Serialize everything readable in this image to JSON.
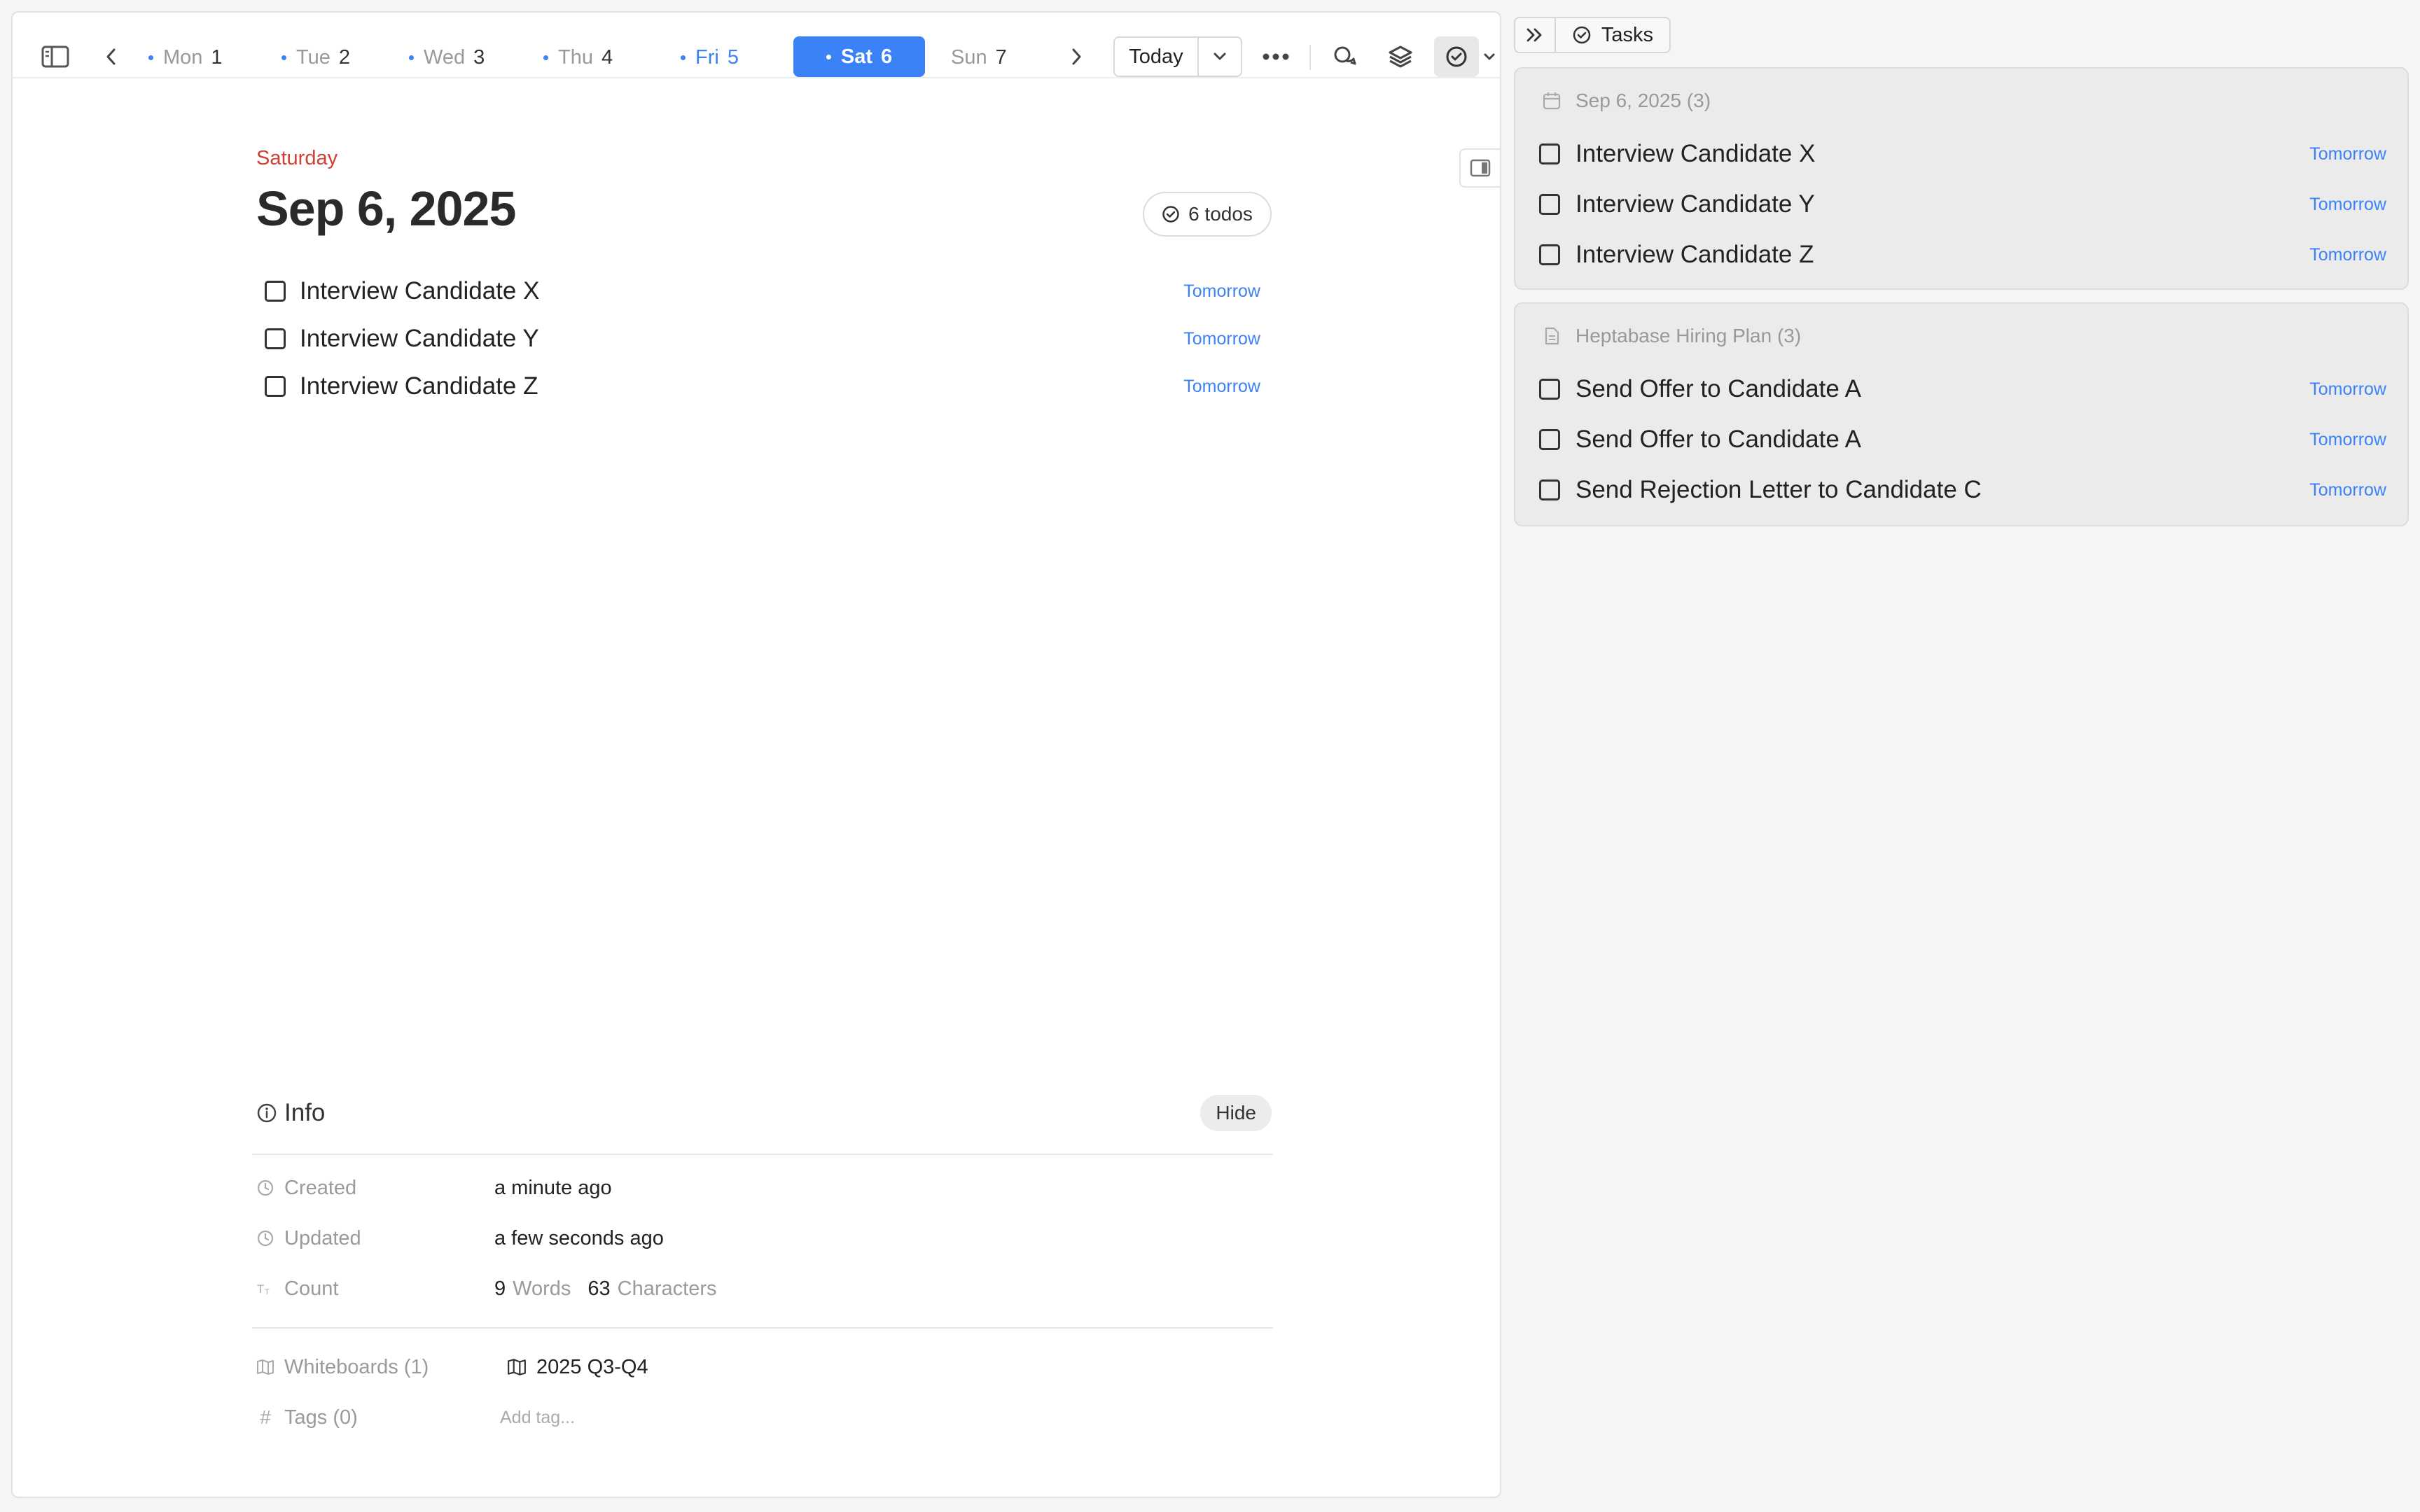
{
  "topbar": {
    "days": [
      {
        "label": "Mon",
        "num": "1"
      },
      {
        "label": "Tue",
        "num": "2"
      },
      {
        "label": "Wed",
        "num": "3"
      },
      {
        "label": "Thu",
        "num": "4"
      },
      {
        "label": "Fri",
        "num": "5"
      },
      {
        "label": "Sat",
        "num": "6"
      },
      {
        "label": "Sun",
        "num": "7"
      }
    ],
    "today_label": "Today",
    "accent": "#3b82f6"
  },
  "journal": {
    "weekday": "Saturday",
    "date": "Sep 6, 2025",
    "todo_count": "6 todos",
    "tasks": [
      {
        "text": "Interview Candidate X",
        "due": "Tomorrow"
      },
      {
        "text": "Interview Candidate Y",
        "due": "Tomorrow"
      },
      {
        "text": "Interview Candidate Z",
        "due": "Tomorrow"
      }
    ]
  },
  "info": {
    "title": "Info",
    "hide_label": "Hide",
    "created_label": "Created",
    "created_value": "a minute ago",
    "updated_label": "Updated",
    "updated_value": "a few seconds ago",
    "count_label": "Count",
    "words_num": "9",
    "words_label": "Words",
    "chars_num": "63",
    "chars_label": "Characters",
    "whiteboards_label": "Whiteboards (1)",
    "whiteboard_name": "2025 Q3-Q4",
    "tags_label": "Tags (0)",
    "add_tag": "Add tag..."
  },
  "tasks_panel": {
    "title": "Tasks",
    "groups": [
      {
        "heading": "Sep 6, 2025 (3)",
        "icon": "calendar-icon",
        "items": [
          {
            "text": "Interview Candidate X",
            "due": "Tomorrow"
          },
          {
            "text": "Interview Candidate Y",
            "due": "Tomorrow"
          },
          {
            "text": "Interview Candidate Z",
            "due": "Tomorrow"
          }
        ]
      },
      {
        "heading": "Heptabase Hiring Plan (3)",
        "icon": "document-icon",
        "items": [
          {
            "text": "Send Offer to Candidate A",
            "due": "Tomorrow"
          },
          {
            "text": "Send Offer to Candidate A",
            "due": "Tomorrow"
          },
          {
            "text": "Send Rejection Letter to Candidate C",
            "due": "Tomorrow"
          }
        ]
      }
    ]
  }
}
